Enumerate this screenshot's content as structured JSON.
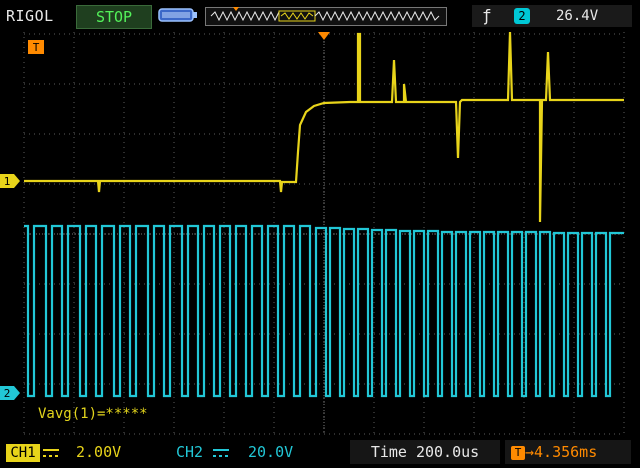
{
  "header": {
    "brand": "RIGOL",
    "run_state": "STOP",
    "trigger": {
      "edge_icon": "rising-edge-icon",
      "source_label": "2",
      "level": "26.4V"
    }
  },
  "markers": {
    "trigger_marker": "T",
    "ch1_marker": "1",
    "ch2_marker": "2"
  },
  "measurement": {
    "text": "Vavg(1)=*****"
  },
  "footer": {
    "ch1_label": "CH1",
    "ch1_scale": "2.00V",
    "ch2_label": "CH2",
    "ch2_scale": "20.0V",
    "time_label": "Time",
    "time_scale": "200.0us",
    "trigger_pos_icon": "T",
    "trigger_pos_value": "4.356ms"
  },
  "colors": {
    "ch1": "#e8d41a",
    "ch2": "#22c7d6",
    "trigger": "#ff8a00",
    "grid": "#5a5a5a",
    "run_state": "#53f25a"
  }
}
